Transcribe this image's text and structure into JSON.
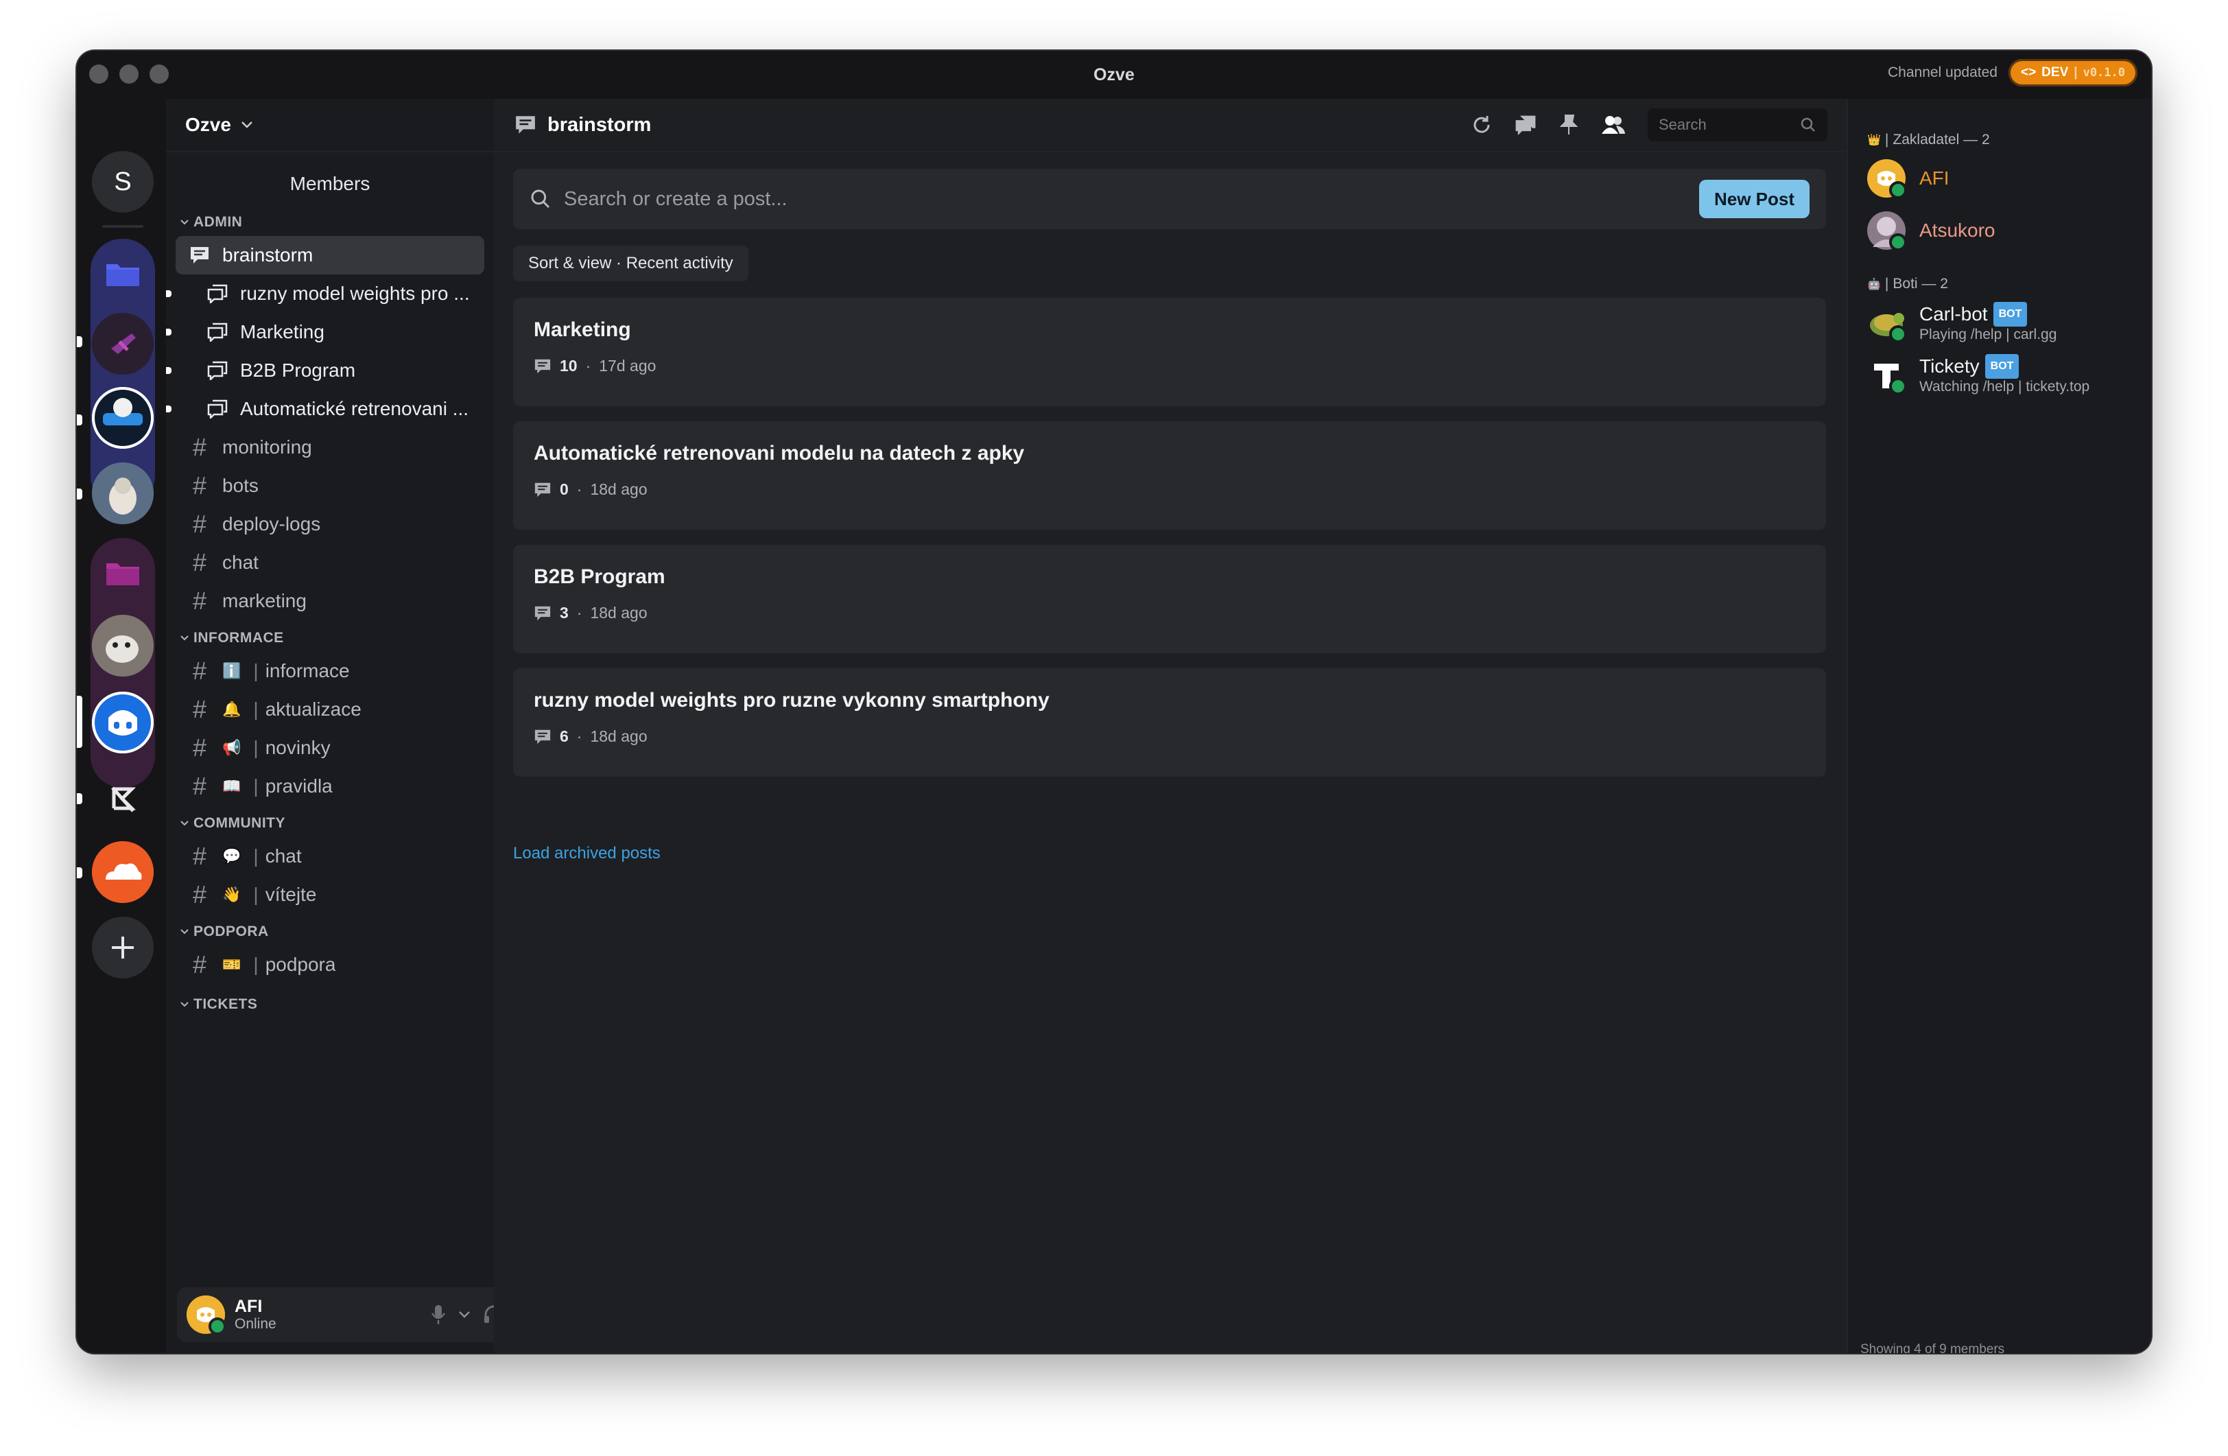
{
  "window": {
    "title": "Ozve",
    "status_text": "Channel updated",
    "dev_badge": {
      "label": "DEV",
      "version": "v0.1.0"
    }
  },
  "server": {
    "name": "Ozve",
    "initial": "S",
    "members_link": "Members"
  },
  "categories": {
    "admin": "ADMIN",
    "informace": "INFORMACE",
    "community": "COMMUNITY",
    "podpora": "PODPORA",
    "tickets": "TICKETS"
  },
  "channels": {
    "brainstorm": "brainstorm",
    "thread1": "ruzny model weights pro ...",
    "thread2": "Marketing",
    "thread3": "B2B Program",
    "thread4": "Automatické retrenovani ...",
    "monitoring": "monitoring",
    "bots": "bots",
    "deploy_logs": "deploy-logs",
    "chat": "chat",
    "marketing": "marketing",
    "informace": "informace",
    "aktualizace": "aktualizace",
    "novinky": "novinky",
    "pravidla": "pravidla",
    "community_chat": "chat",
    "vitejte": "vítejte",
    "podpora": "podpora",
    "pipe": "|",
    "emoji": {
      "informace": "ℹ️",
      "aktualizace": "🔔",
      "novinky": "📢",
      "pravidla": "📖",
      "chat": "💬",
      "vitejte": "👋",
      "podpora": "🎫"
    }
  },
  "user": {
    "name": "AFI",
    "status": "Online"
  },
  "main": {
    "channel_title": "brainstorm",
    "search_placeholder": "Search",
    "post_search_placeholder": "Search or create a post...",
    "new_post_label": "New Post",
    "sort_label": "Sort & view · Recent activity",
    "load_archived": "Load archived posts",
    "posts": [
      {
        "title": "Marketing",
        "count": "10",
        "age": "17d ago"
      },
      {
        "title": "Automatické retrenovani modelu na datech z apky",
        "count": "0",
        "age": "18d ago"
      },
      {
        "title": "B2B Program",
        "count": "3",
        "age": "18d ago"
      },
      {
        "title": "ruzny model weights pro ruzne vykonny smartphony",
        "count": "6",
        "age": "18d ago"
      }
    ],
    "dot": "·"
  },
  "members": {
    "group1_label": "Zakladatel — 2",
    "group1_icon": "👑",
    "group2_label": "Boti — 2",
    "group2_icon": "🤖",
    "pipe": "|",
    "list": [
      {
        "name": "AFI",
        "color": "#e8922e"
      },
      {
        "name": "Atsukoro",
        "color": "#e99a8a"
      },
      {
        "name": "Carl-bot",
        "tag": "BOT",
        "activity": "Playing /help | carl.gg"
      },
      {
        "name": "Tickety",
        "tag": "BOT",
        "activity": "Watching /help | tickety.top"
      }
    ],
    "showing": "Showing 4 of 9 members"
  }
}
